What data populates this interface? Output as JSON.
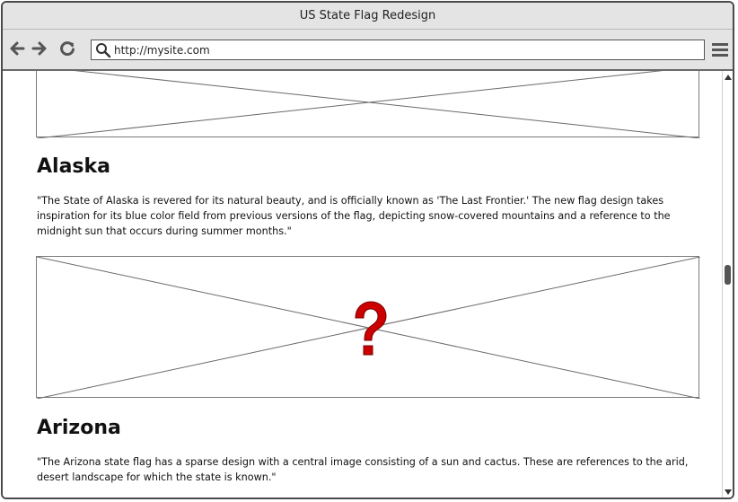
{
  "window": {
    "title": "US State Flag Redesign"
  },
  "toolbar": {
    "back_icon": "arrow-left-icon",
    "forward_icon": "arrow-right-icon",
    "reload_icon": "reload-icon",
    "search_icon": "search-icon",
    "menu_icon": "hamburger-menu-icon",
    "url": "http://mysite.com"
  },
  "sections": [
    {
      "image": "image-placeholder",
      "title": "Alaska",
      "description": "\"The State of Alaska is revered for its natural beauty, and is officially known as 'The Last Frontier.' The new flag design takes inspiration for its blue color field from previous versions of the flag, depicting snow-covered mountains and a reference to the midnight sun that occurs during summer months.\""
    },
    {
      "image": "image-placeholder-missing",
      "title": "Arizona",
      "description": "\"The Arizona state flag has a sparse design with a central image consisting of a sun and cactus. These are references to the arid, desert landscape for which the state is known.\""
    }
  ],
  "colors": {
    "chrome": "#e4e4e4",
    "border": "#4a4a4a",
    "missing_image_mark": "#cc0000"
  }
}
